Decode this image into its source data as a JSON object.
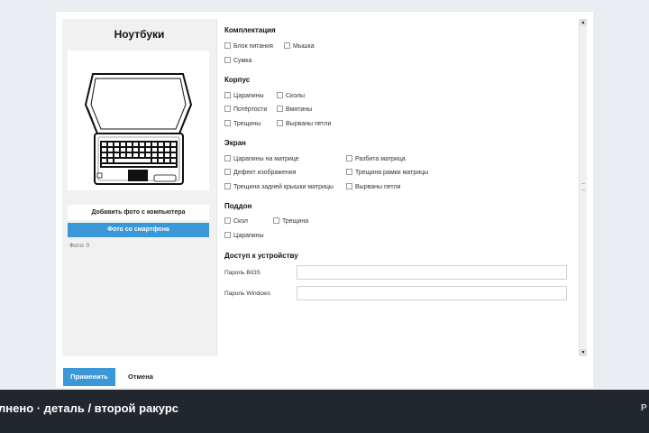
{
  "left_panel": {
    "title": "Ноутбуки",
    "add_photo_button": "Добавить фото с компьютера",
    "phone_photo_button": "Фото со смартфона",
    "photo_count": "Фото: 0"
  },
  "sections": {
    "kit": {
      "title": "Комплектация",
      "items": [
        "Блок питания",
        "Мышка",
        "Сумка"
      ]
    },
    "case": {
      "title": "Корпус",
      "items": [
        "Царапины",
        "Сколы",
        "Потёртости",
        "Вмятины",
        "Трещины",
        "Вырваны петли"
      ]
    },
    "screen": {
      "title": "Экран",
      "items": [
        "Царапины на матрице",
        "Разбита матрица",
        "Дефект изображения",
        "Трещина рамки матрицы",
        "Трещина задней крышки матрицы",
        "Вырваны петли"
      ]
    },
    "tray": {
      "title": "Поддон",
      "items": [
        "Скол",
        "Трещина",
        "Царапины"
      ]
    },
    "access": {
      "title": "Доступ к устройству",
      "fields": [
        {
          "label": "Пароль BIOS",
          "value": ""
        },
        {
          "label": "Пароль Windows",
          "value": ""
        }
      ]
    }
  },
  "footer": {
    "apply": "Применить",
    "cancel": "Отмена"
  },
  "bottom_bar": {
    "caption": "лнено · деталь / второй ракурс",
    "corner": "Р"
  },
  "colors": {
    "accent": "#3b98d8",
    "bar": "#22272e",
    "panel": "#f1f1f1"
  },
  "icons": {
    "photo": "laptop-illustration"
  }
}
